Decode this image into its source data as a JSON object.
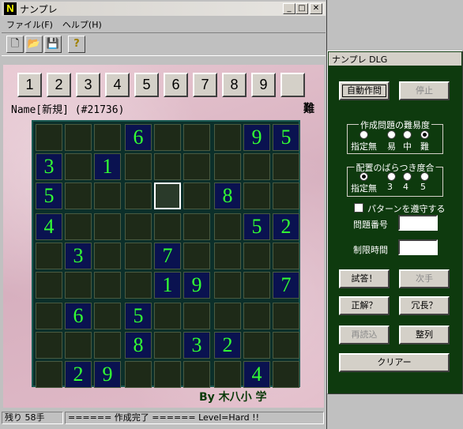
{
  "main": {
    "title": "ナンプレ",
    "app_icon": "N",
    "menu": [
      "ファイル(F)",
      "ヘルプ(H)"
    ],
    "toolbar_icons": [
      "new-icon",
      "open-icon",
      "save-icon",
      "help-icon"
    ],
    "toolbar_glyphs": [
      "🗋",
      "📂",
      "💾",
      "?"
    ],
    "number_buttons": [
      "1",
      "2",
      "3",
      "4",
      "5",
      "6",
      "7",
      "8",
      "9",
      ""
    ],
    "name_line": "Name[新規] (#21736)",
    "difficulty_mark": "難",
    "byline": "By 木八小 学",
    "grid": [
      [
        "",
        "",
        "",
        "6",
        "",
        "",
        "",
        "9",
        "5"
      ],
      [
        "3",
        "",
        "1",
        "",
        "",
        "",
        "",
        "",
        ""
      ],
      [
        "5",
        "",
        "",
        "",
        "",
        "",
        "8",
        "",
        ""
      ],
      [
        "4",
        "",
        "",
        "",
        "",
        "",
        "",
        "5",
        "2"
      ],
      [
        "",
        "3",
        "",
        "",
        "7",
        "",
        "",
        "",
        ""
      ],
      [
        "",
        "",
        "",
        "",
        "1",
        "9",
        "",
        "",
        "7"
      ],
      [
        "",
        "6",
        "",
        "5",
        "",
        "",
        "",
        "",
        ""
      ],
      [
        "",
        "",
        "",
        "8",
        "",
        "3",
        "2",
        "",
        ""
      ],
      [
        "",
        "2",
        "9",
        "",
        "",
        "",
        "",
        "4",
        ""
      ]
    ],
    "selected_cell": [
      2,
      4
    ],
    "status": {
      "remaining": "残り 58手",
      "message": "====== 作成完了 ======  Level=Hard !!"
    }
  },
  "dlg": {
    "title": "ナンプレ DLG",
    "auto_create": "自動作問",
    "stop": "停止",
    "difficulty_group": "作成問題の難易度",
    "difficulty_options": [
      "指定無",
      "易",
      "中",
      "難"
    ],
    "difficulty_selected": 3,
    "variance_group": "配置のばらつき度合",
    "variance_options": [
      "指定無",
      "3",
      "4",
      "5"
    ],
    "variance_selected": 0,
    "pattern_check": "パターンを遵守する",
    "problem_no_label": "問題番号",
    "time_limit_label": "制限時間",
    "try_answer": "試答！",
    "next_move": "次手",
    "correct": "正解？",
    "redundant": "冗長？",
    "reload": "再読込",
    "arrange": "整列",
    "clear": "クリアー"
  }
}
